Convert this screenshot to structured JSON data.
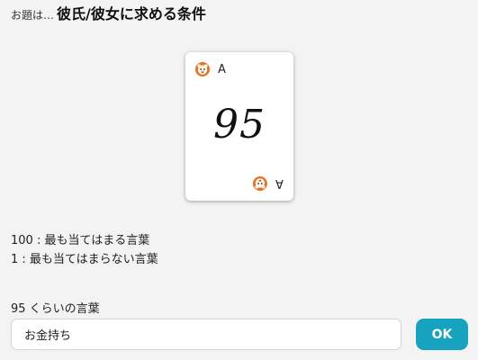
{
  "topic": {
    "prefix": "お題は…",
    "title": "彼氏/彼女に求める条件"
  },
  "card": {
    "rank": "A",
    "number": "95",
    "badge_icon": "tiger-face-icon",
    "badge_color": "#e8701e"
  },
  "legend": {
    "high": "100 : 最も当てはまる言葉",
    "low": "1 : 最も当てはまらない言葉"
  },
  "prompt": "95 くらいの言葉",
  "answer": {
    "value": "お金持ち"
  },
  "ok_button": {
    "label": "OK",
    "color": "#17a3c0"
  }
}
